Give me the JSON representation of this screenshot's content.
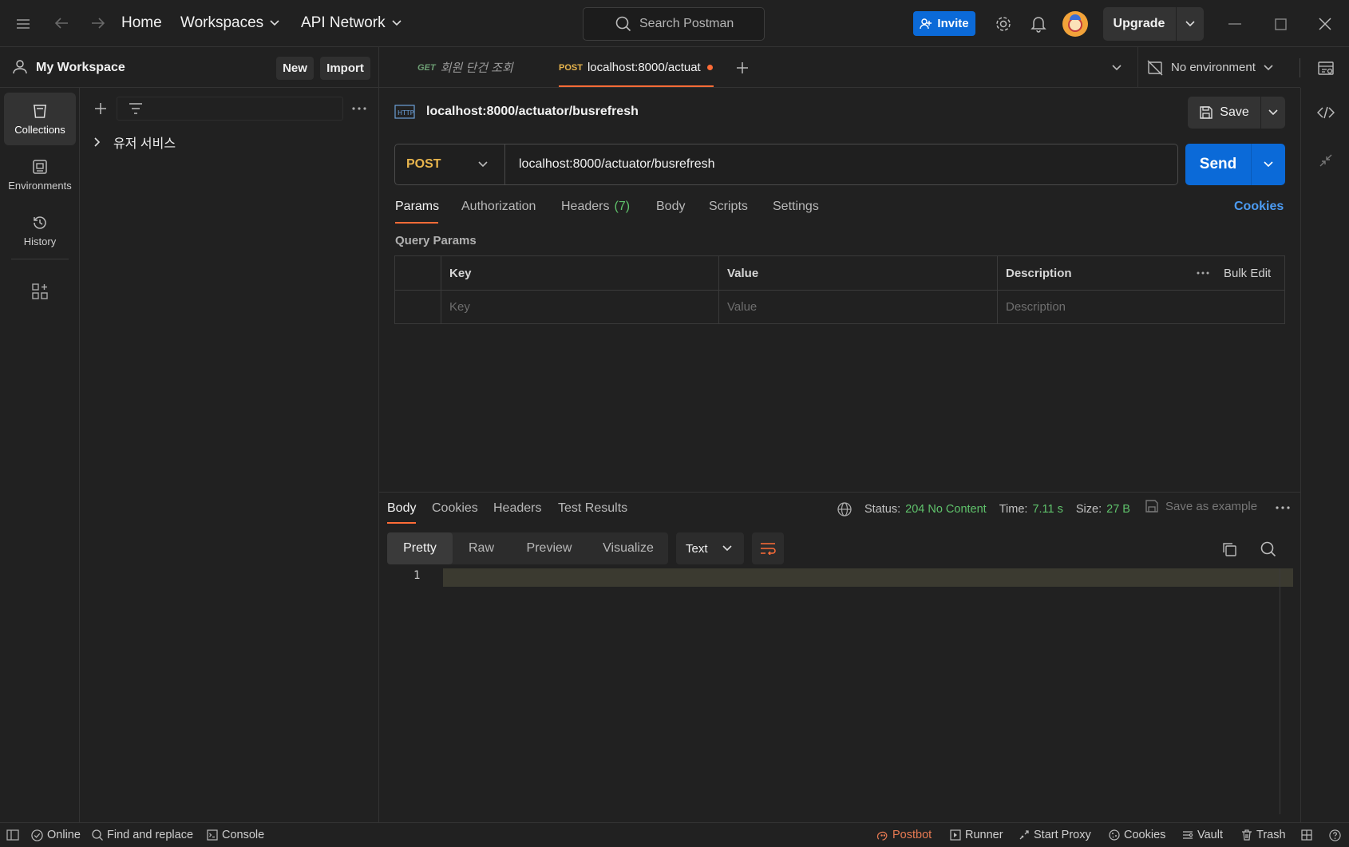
{
  "topbar": {
    "home": "Home",
    "workspaces": "Workspaces",
    "api_network": "API Network",
    "search_placeholder": "Search Postman",
    "invite": "Invite",
    "upgrade": "Upgrade"
  },
  "workspace": {
    "name": "My Workspace",
    "new": "New",
    "import": "Import"
  },
  "rail": [
    {
      "label": "Collections",
      "icon": "collections-icon"
    },
    {
      "label": "Environments",
      "icon": "environments-icon"
    },
    {
      "label": "History",
      "icon": "history-icon"
    }
  ],
  "sidebar": {
    "collection_name": "유저 서비스"
  },
  "tabs": [
    {
      "method": "GET",
      "title": "회원 단건 조회",
      "method_color": "#5fa86a"
    },
    {
      "method": "POST",
      "title": "localhost:8000/actuat",
      "method_color": "#e8b54d",
      "unsaved": true
    }
  ],
  "environment": {
    "selected": "No environment"
  },
  "request": {
    "title": "localhost:8000/actuator/busrefresh",
    "save": "Save",
    "method": "POST",
    "url": "localhost:8000/actuator/busrefresh",
    "send": "Send",
    "tabs": [
      "Params",
      "Authorization",
      "Headers",
      "Body",
      "Scripts",
      "Settings"
    ],
    "headers_count": "(7)",
    "cookies": "Cookies",
    "query_params_title": "Query Params",
    "columns": [
      "Key",
      "Value",
      "Description"
    ],
    "bulk_edit": "Bulk Edit",
    "placeholders": {
      "key": "Key",
      "value": "Value",
      "description": "Description"
    }
  },
  "response": {
    "tabs": [
      "Body",
      "Cookies",
      "Headers",
      "Test Results"
    ],
    "status_label": "Status:",
    "status_value": "204 No Content",
    "time_label": "Time:",
    "time_value": "7.11 s",
    "size_label": "Size:",
    "size_value": "27 B",
    "save_example": "Save as example",
    "views": [
      "Pretty",
      "Raw",
      "Preview",
      "Visualize"
    ],
    "format": "Text",
    "line_number": "1"
  },
  "statusbar": {
    "online": "Online",
    "find_replace": "Find and replace",
    "console": "Console",
    "postbot": "Postbot",
    "runner": "Runner",
    "start_proxy": "Start Proxy",
    "cookies": "Cookies",
    "vault": "Vault",
    "trash": "Trash"
  },
  "colors": {
    "accent_blue": "#0b6ad8",
    "status_green": "#5fc26b",
    "post_orange": "#e8b54d",
    "tab_active_orange": "#ff6c37"
  }
}
